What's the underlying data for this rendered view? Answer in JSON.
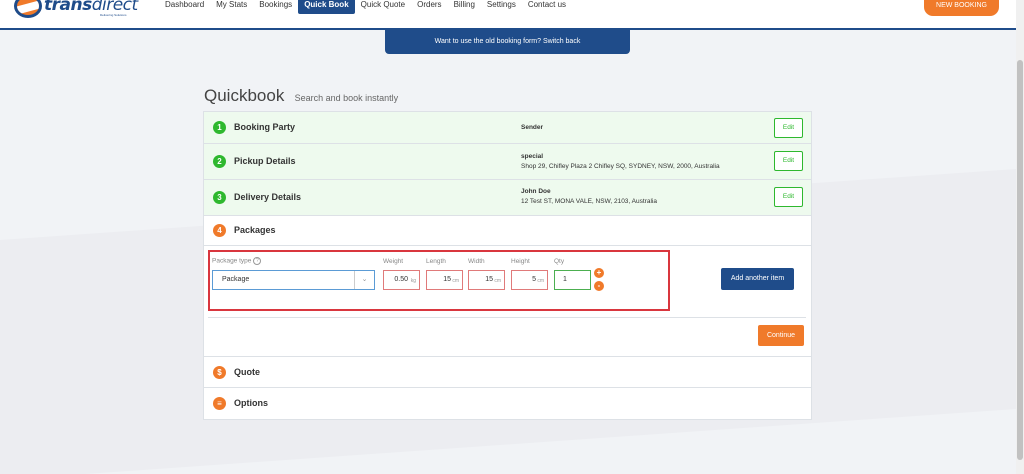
{
  "header": {
    "logo": {
      "brand_bold": "trans",
      "brand_thin": "direct",
      "tagline": "Delivering Solutions"
    },
    "nav": [
      "Dashboard",
      "My Stats",
      "Bookings",
      "Quick Book",
      "Quick Quote",
      "Orders",
      "Billing",
      "Settings",
      "Contact us"
    ],
    "active_nav": "Quick Book",
    "new_booking_label": "NEW BOOKING"
  },
  "banner": {
    "text": "Want to use the old booking form? Switch back"
  },
  "page": {
    "title": "Quickbook",
    "subtitle": "Search and book instantly"
  },
  "steps": [
    {
      "number": "1",
      "title": "Booking Party",
      "info_bold": "Sender",
      "info_line": "",
      "edit_label": "Edit"
    },
    {
      "number": "2",
      "title": "Pickup Details",
      "info_bold": "special",
      "info_line": "Shop 29, Chifley Plaza 2 Chifley SQ, SYDNEY, NSW, 2000, Australia",
      "edit_label": "Edit"
    },
    {
      "number": "3",
      "title": "Delivery Details",
      "info_bold": "John Doe",
      "info_line": "12 Test ST, MONA VALE, NSW, 2103, Australia",
      "edit_label": "Edit"
    },
    {
      "number": "4",
      "title": "Packages"
    }
  ],
  "packages": {
    "package_type_label": "Package type",
    "package_type_value": "Package",
    "weight": {
      "label": "Weight",
      "value": "0.50",
      "unit": "kg"
    },
    "length": {
      "label": "Length",
      "value": "15",
      "unit": "cm"
    },
    "width": {
      "label": "Width",
      "value": "15",
      "unit": "cm"
    },
    "height": {
      "label": "Height",
      "value": "5",
      "unit": "cm"
    },
    "qty": {
      "label": "Qty",
      "value": "1"
    },
    "add_item_label": "Add another item",
    "continue_label": "Continue"
  },
  "quote": {
    "title": "Quote"
  },
  "options": {
    "title": "Options"
  },
  "colors": {
    "brand_blue": "#1f4c8a",
    "brand_orange": "#f07a2a",
    "success_green": "#2eb82e",
    "highlight_red": "#d9363e"
  }
}
